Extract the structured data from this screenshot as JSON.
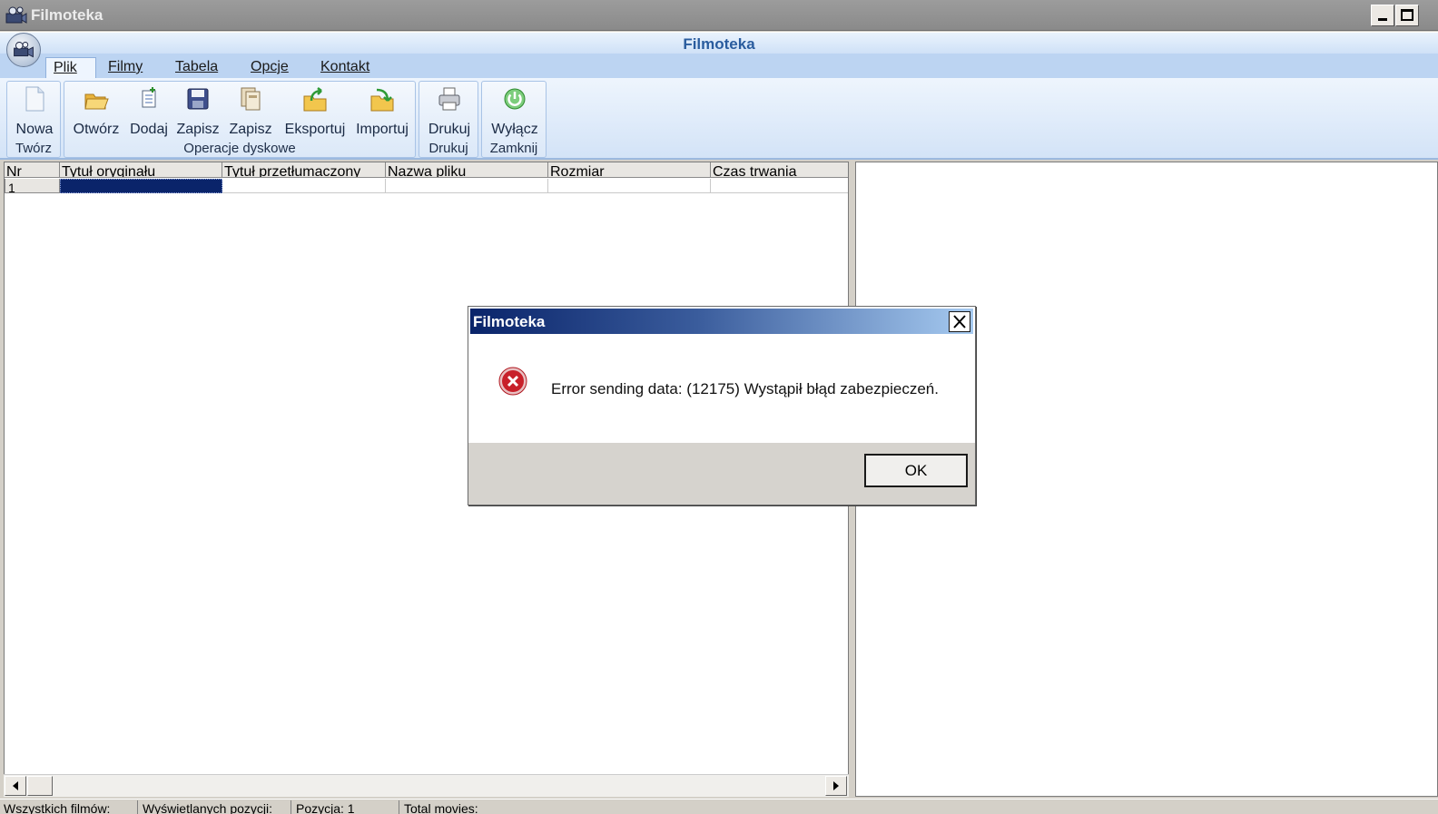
{
  "window": {
    "title": "Filmoteka"
  },
  "ribbon": {
    "title": "Filmoteka",
    "tabs": [
      {
        "label": "Plik",
        "active": true
      },
      {
        "label": "Filmy"
      },
      {
        "label": "Tabela"
      },
      {
        "label": "Opcje"
      },
      {
        "label": "Kontakt"
      }
    ],
    "groups": [
      {
        "label": "Twórz",
        "buttons": [
          {
            "label": "Nowa",
            "icon": "new-document-icon"
          }
        ]
      },
      {
        "label": "Operacje dyskowe",
        "buttons": [
          {
            "label": "Otwórz",
            "icon": "folder-open-icon"
          },
          {
            "label": "Dodaj",
            "icon": "add-document-icon"
          },
          {
            "label": "Zapisz",
            "icon": "floppy-disk-icon"
          },
          {
            "label": "Zapisz",
            "icon": "save-as-icon"
          },
          {
            "label": "Eksportuj",
            "icon": "folder-export-icon"
          },
          {
            "label": "Importuj",
            "icon": "folder-import-icon"
          }
        ]
      },
      {
        "label": "Drukuj",
        "buttons": [
          {
            "label": "Drukuj",
            "icon": "printer-icon"
          }
        ]
      },
      {
        "label": "Zamknij",
        "buttons": [
          {
            "label": "Wyłącz",
            "icon": "power-icon"
          }
        ]
      }
    ]
  },
  "grid": {
    "columns": [
      "Nr",
      "Tytuł oryginału",
      "Tytuł przetłumaczony",
      "Nazwa pliku",
      "Rozmiar",
      "Czas trwania"
    ],
    "rows": [
      [
        "1",
        "",
        "",
        "",
        "",
        ""
      ]
    ]
  },
  "status": {
    "panels": [
      "Wszystkich filmów:",
      "Wyświetlanych pozycji:",
      "Pozycja: 1",
      "Total movies:"
    ]
  },
  "dialog": {
    "title": "Filmoteka",
    "message": "Error sending data: (12175) Wystąpił błąd zabezpieczeń.",
    "ok_label": "OK",
    "icon": "error-icon"
  },
  "colors": {
    "dialog_title_start": "#0a246a",
    "dialog_title_end": "#a6caf0",
    "ribbon_title": "#2a5c9e",
    "error_red": "#c8202a"
  }
}
